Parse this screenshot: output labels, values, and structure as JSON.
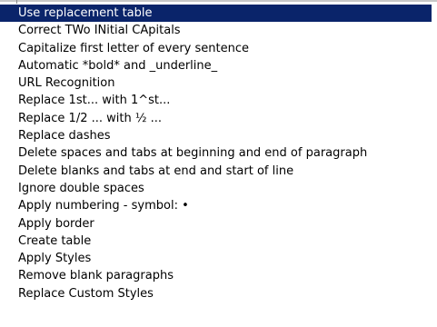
{
  "autocorrect_options": {
    "selected_index": 0,
    "items": [
      {
        "label": "Use replacement table"
      },
      {
        "label": "Correct TWo INitial CApitals"
      },
      {
        "label": "Capitalize first letter of every sentence"
      },
      {
        "label": "Automatic *bold* and _underline_"
      },
      {
        "label": "URL Recognition"
      },
      {
        "label": "Replace 1st... with 1^st..."
      },
      {
        "label": "Replace 1/2 ... with ½ ..."
      },
      {
        "label": "Replace dashes"
      },
      {
        "label": "Delete spaces and tabs at beginning and end of paragraph"
      },
      {
        "label": "Delete blanks and tabs at end and start of line"
      },
      {
        "label": "Ignore double spaces"
      },
      {
        "label": "Apply numbering - symbol: •"
      },
      {
        "label": "Apply border"
      },
      {
        "label": "Create table"
      },
      {
        "label": "Apply Styles"
      },
      {
        "label": "Remove blank paragraphs"
      },
      {
        "label": "Replace Custom Styles"
      }
    ]
  },
  "colors": {
    "selection_background": "#0a246a",
    "selection_text": "#ffffff",
    "text": "#000000",
    "background": "#ffffff"
  }
}
